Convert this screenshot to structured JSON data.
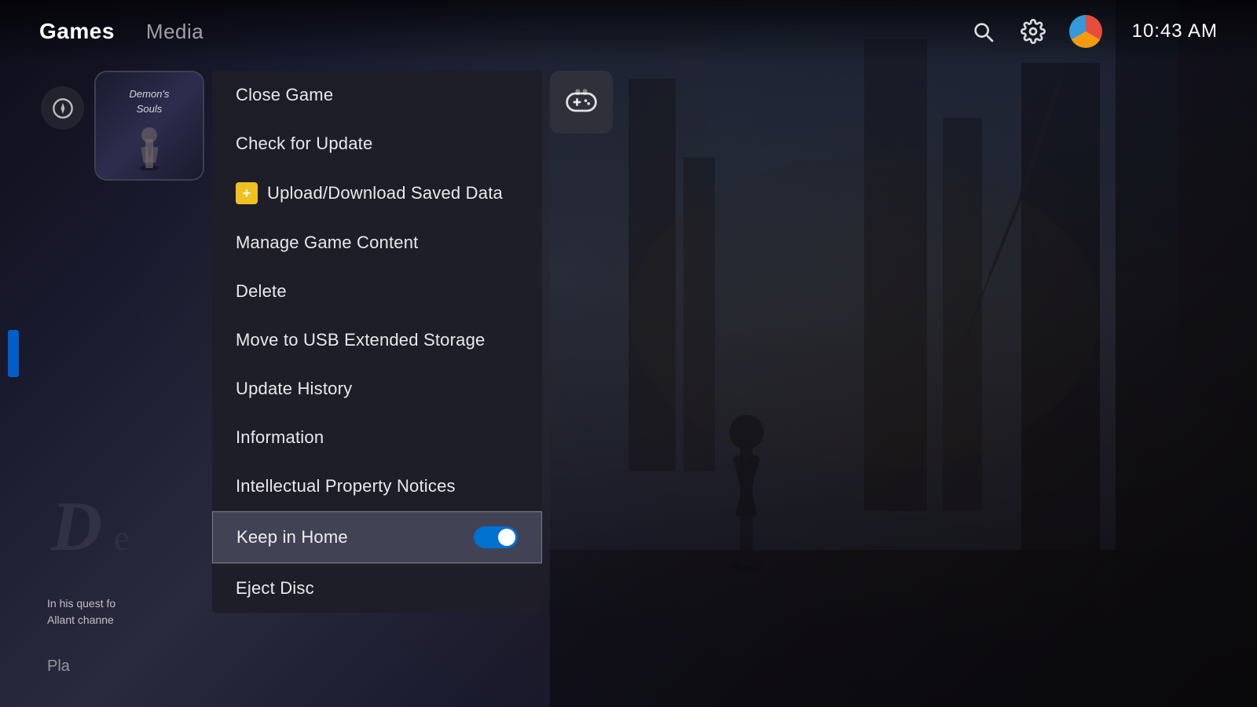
{
  "topbar": {
    "nav_games": "Games",
    "nav_media": "Media",
    "time": "10:43 AM"
  },
  "game": {
    "title_line1": "Demon's",
    "title_line2": "Souls",
    "description_line1": "In his quest fo",
    "description_line2": "Allant channe",
    "play_label": "Pla"
  },
  "context_menu": {
    "items": [
      {
        "id": "close-game",
        "label": "Close Game",
        "icon": null,
        "highlighted": false
      },
      {
        "id": "check-update",
        "label": "Check for Update",
        "icon": null,
        "highlighted": false
      },
      {
        "id": "upload-download",
        "label": "Upload/Download Saved Data",
        "icon": "ps-plus",
        "highlighted": false
      },
      {
        "id": "manage-content",
        "label": "Manage Game Content",
        "icon": null,
        "highlighted": false
      },
      {
        "id": "delete",
        "label": "Delete",
        "icon": null,
        "highlighted": false
      },
      {
        "id": "move-usb",
        "label": "Move to USB Extended Storage",
        "icon": null,
        "highlighted": false
      },
      {
        "id": "update-history",
        "label": "Update History",
        "icon": null,
        "highlighted": false
      },
      {
        "id": "information",
        "label": "Information",
        "icon": null,
        "highlighted": false
      },
      {
        "id": "ip-notices",
        "label": "Intellectual Property Notices",
        "icon": null,
        "highlighted": false
      },
      {
        "id": "keep-home",
        "label": "Keep in Home",
        "icon": null,
        "highlighted": true,
        "toggle": true,
        "toggle_on": true
      },
      {
        "id": "eject-disc",
        "label": "Eject Disc",
        "icon": null,
        "highlighted": false
      }
    ]
  },
  "icons": {
    "search": "🔍",
    "gear": "⚙",
    "gamepad": "🎮",
    "compass": "◎",
    "ps_plus_symbol": "+"
  }
}
